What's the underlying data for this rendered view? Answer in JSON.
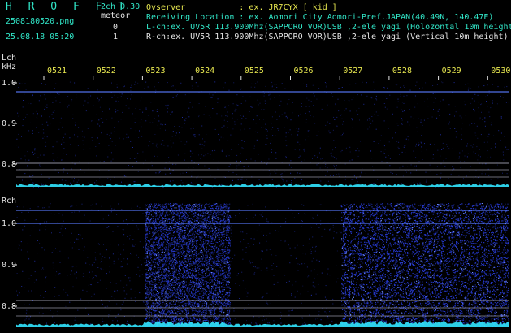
{
  "header": {
    "brand": "H R O F F T",
    "mode": "2ch 0.30",
    "filename": "2508180520.png",
    "meteor_label": "meteor",
    "datetime": "25.08.18 05:20",
    "count_l": "0",
    "count_r": "1",
    "observer": "Ovserver           : ex. JR7CYX [ kid ]",
    "location": "Receiving Location : ex. Aomori City Aomori-Pref.JAPAN(40.49N, 140.47E)",
    "lch_info": "L-ch:ex. UV5R 113.900Mhz(SAPPORO VOR)USB ,2-ele yagi (Holozontal 10m height)",
    "rch_info": "R-ch:ex. UV5R 113.900Mhz(SAPPORO VOR)USB ,2-ele yagi (Vertical 10m height)"
  },
  "panels": {
    "lch": {
      "channel": "Lch",
      "unit": "kHz",
      "yticks": [
        "1.0",
        "0.9",
        "0.8"
      ]
    },
    "rch": {
      "channel": "Rch",
      "yticks": [
        "1.0",
        "0.9",
        "0.8"
      ]
    }
  },
  "time_labels": [
    "0521",
    "0522",
    "0523",
    "0524",
    "0525",
    "0526",
    "0527",
    "0528",
    "0529",
    "0530"
  ],
  "colors": {
    "background": "#000000",
    "header_text": "#31e6c8",
    "time_labels": "#e8e850",
    "axis_labels": "#e6e6e6",
    "tick_marks": "#e6e6e6",
    "signal_cyan": "#32e6ff",
    "noise_blue": "#2638c8",
    "reference_lines": "#b4b4c8"
  }
}
